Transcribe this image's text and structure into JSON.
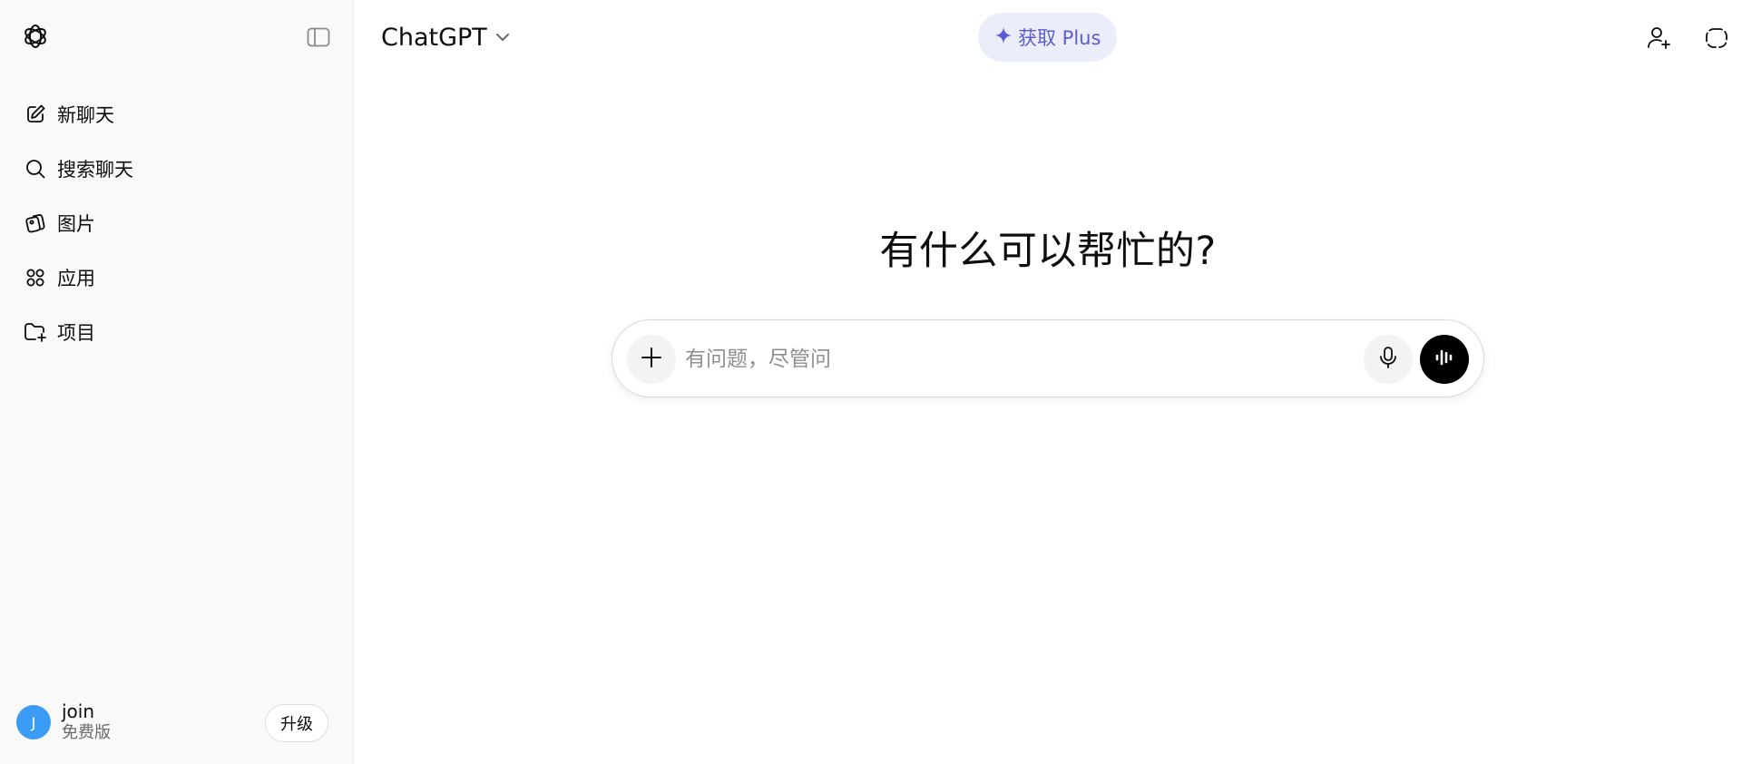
{
  "sidebar": {
    "logo_icon": "openai-logo-icon",
    "toggle_icon": "sidebar-toggle-icon",
    "items": [
      {
        "label": "新聊天",
        "icon": "edit-icon"
      },
      {
        "label": "搜索聊天",
        "icon": "search-icon"
      },
      {
        "label": "图片",
        "icon": "images-icon"
      },
      {
        "label": "应用",
        "icon": "apps-icon"
      },
      {
        "label": "项目",
        "icon": "folder-plus-icon"
      }
    ],
    "account": {
      "avatar_letter": "J",
      "name": "join",
      "plan": "免费版",
      "upgrade_label": "升级",
      "avatar_color": "#3b9cf5"
    }
  },
  "header": {
    "model_name": "ChatGPT",
    "plus_label": "获取 Plus",
    "plus_icon": "sparkle-icon",
    "plus_color": "#5b5bd6",
    "right_icons": [
      "add-person-icon",
      "temporary-chat-icon"
    ]
  },
  "main": {
    "headline": "有什么可以帮忙的?",
    "composer": {
      "placeholder": "有问题，尽管问",
      "attach_icon": "plus-icon",
      "mic_icon": "microphone-icon",
      "voice_icon": "voice-mode-icon"
    }
  }
}
